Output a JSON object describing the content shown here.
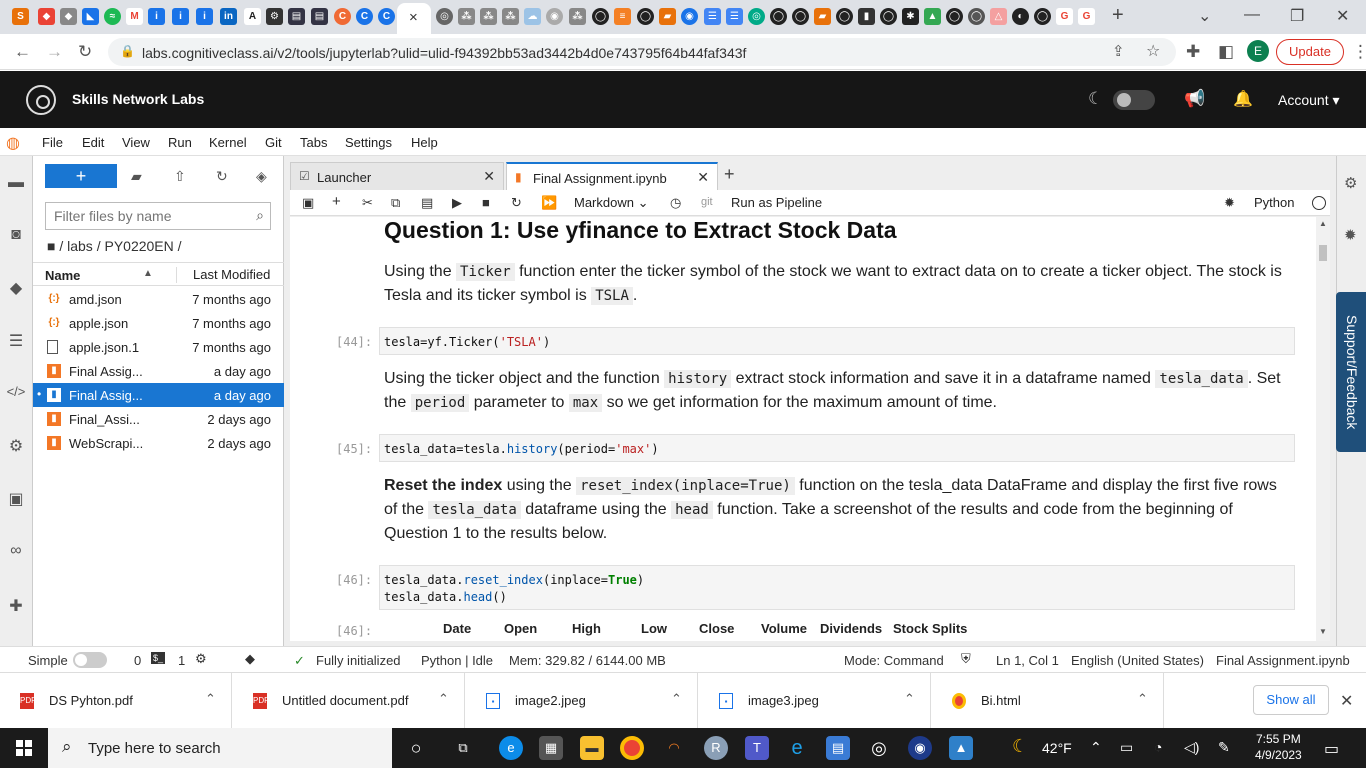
{
  "browser": {
    "url": "labs.cognitiveclass.ai/v2/tools/jupyterlab?ulid=ulid-f94392bb53ad3442b4d0e743795f64b44faf343f",
    "update_label": "Update",
    "profile_initial": "E",
    "new_tab": "+",
    "active_tab_close": "×"
  },
  "header": {
    "title": "Skills Network Labs",
    "account_label": "Account ▾"
  },
  "menu": {
    "items": [
      "File",
      "Edit",
      "View",
      "Run",
      "Kernel",
      "Git",
      "Tabs",
      "Settings",
      "Help"
    ]
  },
  "filebrowser": {
    "new_label": "+",
    "filter_placeholder": "Filter files by name",
    "breadcrumb": "■ / labs / PY0220EN /",
    "col_name": "Name",
    "col_modified": "Last Modified",
    "files": [
      {
        "name": "amd.json",
        "modified": "7 months ago",
        "icon": "json-icon"
      },
      {
        "name": "apple.json",
        "modified": "7 months ago",
        "icon": "json-icon"
      },
      {
        "name": "apple.json.1",
        "modified": "7 months ago",
        "icon": "file-icon"
      },
      {
        "name": "Final Assig...",
        "modified": "a day ago",
        "icon": "notebook-icon"
      },
      {
        "name": "Final Assig...",
        "modified": "a day ago",
        "icon": "notebook-icon"
      },
      {
        "name": "Final_Assi...",
        "modified": "2 days ago",
        "icon": "notebook-icon"
      },
      {
        "name": "WebScrapi...",
        "modified": "2 days ago",
        "icon": "notebook-icon"
      }
    ]
  },
  "tabs": {
    "launcher": "Launcher",
    "notebook": "Final Assignment.ipynb"
  },
  "toolbar": {
    "cell_type": "Markdown",
    "git": "git",
    "pipeline": "Run as Pipeline",
    "kernel": "Python"
  },
  "notebook": {
    "heading": "Question 1: Use yfinance to Extract Stock Data",
    "md1_a": "Using the ",
    "md1_code1": "Ticker",
    "md1_b": " function enter the ticker symbol of the stock we want to extract data on to create a ticker object. The stock is Tesla and its ticker symbol is ",
    "md1_code2": "TSLA",
    "md1_c": ".",
    "p44": "[44]:",
    "md2_a": "Using the ticker object and the function ",
    "md2_code1": "history",
    "md2_b": " extract stock information and save it in a dataframe named ",
    "md2_code2": "tesla_data",
    "md2_c": ". Set the ",
    "md2_code3": "period",
    "md2_d": " parameter to ",
    "md2_code4": "max",
    "md2_e": " so we get information for the maximum amount of time.",
    "p45": "[45]:",
    "md3_bold": "Reset the index",
    "md3_a": " using the ",
    "md3_code1": "reset_index(inplace=True)",
    "md3_b": " function on the tesla_data DataFrame and display the first five rows of the ",
    "md3_code2": "tesla_data",
    "md3_c": " dataframe using the ",
    "md3_code3": "head",
    "md3_d": " function. Take a screenshot of the results and code from the beginning of Question 1 to the results below.",
    "p46": "[46]:",
    "p46_out": "[46]:",
    "out_headers": [
      "Date",
      "Open",
      "High",
      "Low",
      "Close",
      "Volume",
      "Dividends",
      "Stock Splits"
    ]
  },
  "support_label": "Support/Feedback",
  "statusbar": {
    "mode": "Simple",
    "count0": "0",
    "count1": "1",
    "initialized": "Fully initialized",
    "kernel_state": "Python | Idle",
    "mem": "Mem: 329.82 / 6144.00 MB",
    "command_mode": "Mode: Command",
    "position": "Ln 1, Col 1",
    "language": "English (United States)",
    "filename": "Final Assignment.ipynb"
  },
  "downloads": {
    "items": [
      {
        "name": "DS Pyhton.pdf",
        "type": "pdf"
      },
      {
        "name": "Untitled document.pdf",
        "type": "pdf"
      },
      {
        "name": "image2.jpeg",
        "type": "image"
      },
      {
        "name": "image3.jpeg",
        "type": "image"
      },
      {
        "name": "Bi.html",
        "type": "chrome"
      }
    ],
    "show_all": "Show all"
  },
  "taskbar": {
    "search_placeholder": "Type here to search",
    "weather": "42°F",
    "time": "7:55 PM",
    "date": "4/9/2023"
  },
  "colors": {
    "accent": "#1976d2",
    "header_bg": "#161616",
    "update_red": "#d93025"
  }
}
